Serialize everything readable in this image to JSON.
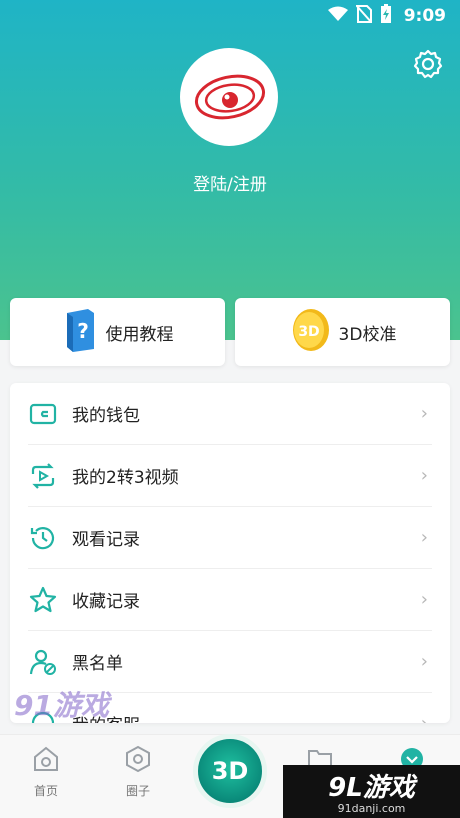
{
  "status": {
    "time": "9:09"
  },
  "profile": {
    "login_label": "登陆/注册"
  },
  "quick": [
    {
      "label": "使用教程"
    },
    {
      "label": "3D校准",
      "badge": "3D"
    }
  ],
  "menu": [
    {
      "label": "我的钱包",
      "icon": "wallet-icon"
    },
    {
      "label": "我的2转3视频",
      "icon": "convert-video-icon"
    },
    {
      "label": "观看记录",
      "icon": "history-icon"
    },
    {
      "label": "收藏记录",
      "icon": "star-icon"
    },
    {
      "label": "黑名单",
      "icon": "blocked-user-icon"
    },
    {
      "label": "我的客服",
      "icon": "service-icon"
    }
  ],
  "tabs": [
    {
      "label": "首页"
    },
    {
      "label": "圈子"
    },
    {
      "label": "3D"
    }
  ],
  "watermark": {
    "left": "91游戏",
    "right_big": "9L游戏",
    "right_small": "91danji.com"
  },
  "colors": {
    "accent": "#21b3a4",
    "header_top": "#1fb4c6",
    "header_bottom": "#4bc38e"
  }
}
